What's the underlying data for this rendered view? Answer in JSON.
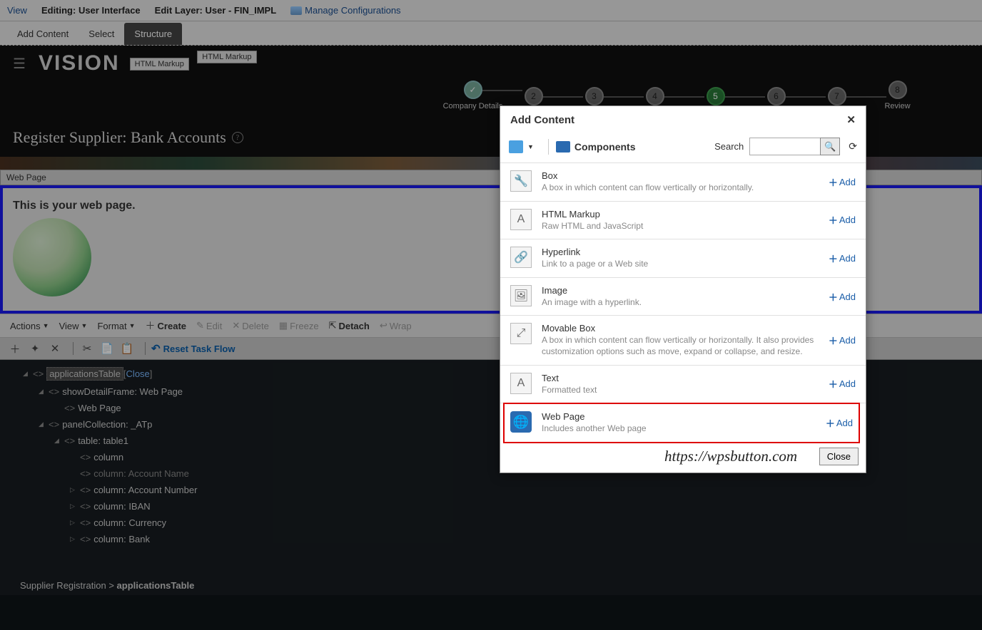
{
  "topbar": {
    "view": "View",
    "editing": "Editing: User Interface",
    "layer": "Edit Layer: User - FIN_IMPL",
    "manage": "Manage Configurations"
  },
  "tabs": {
    "add_content": "Add Content",
    "select": "Select",
    "structure": "Structure"
  },
  "badges": {
    "html1": "HTML Markup",
    "html2": "HTML Markup"
  },
  "logo": "VISION",
  "steps": [
    {
      "num": "✓",
      "label": "Company Details"
    },
    {
      "num": "2",
      "label": ""
    },
    {
      "num": "3",
      "label": ""
    },
    {
      "num": "4",
      "label": ""
    },
    {
      "num": "5",
      "label": ""
    },
    {
      "num": "6",
      "label": ""
    },
    {
      "num": "7",
      "label": ""
    },
    {
      "num": "8",
      "label": "Review"
    }
  ],
  "page_title": "Register Supplier: Bank Accounts",
  "selection_banner": "Web Page",
  "web_page_text": "This is your web page.",
  "toolbar": {
    "actions": "Actions",
    "view": "View",
    "format": "Format",
    "create": "Create",
    "edit": "Edit",
    "delete": "Delete",
    "freeze": "Freeze",
    "detach": "Detach",
    "wrap": "Wrap"
  },
  "reset": "Reset Task Flow",
  "tree": [
    {
      "indent": 1,
      "tri": "◢",
      "text": "applicationsTable",
      "selected": true,
      "close": "Close"
    },
    {
      "indent": 2,
      "tri": "◢",
      "text": "showDetailFrame: Web Page"
    },
    {
      "indent": 3,
      "tri": "",
      "text": "Web Page"
    },
    {
      "indent": 2,
      "tri": "◢",
      "text": "panelCollection: _ATp"
    },
    {
      "indent": 3,
      "tri": "◢",
      "text": "table: table1"
    },
    {
      "indent": 4,
      "tri": "",
      "text": "column"
    },
    {
      "indent": 4,
      "tri": "",
      "text": "column: Account Name",
      "dim": true
    },
    {
      "indent": 4,
      "tri": "▷",
      "text": "column: Account Number"
    },
    {
      "indent": 4,
      "tri": "▷",
      "text": "column: IBAN"
    },
    {
      "indent": 4,
      "tri": "▷",
      "text": "column: Currency"
    },
    {
      "indent": 4,
      "tri": "▷",
      "text": "column: Bank"
    }
  ],
  "breadcrumb": {
    "a": "Supplier Registration",
    "sep": ">",
    "b": "applicationsTable"
  },
  "dialog": {
    "title": "Add Content",
    "components_label": "Components",
    "search_label": "Search",
    "search_placeholder": "",
    "add_label": "Add",
    "close_label": "Close",
    "watermark": "https://wpsbutton.com",
    "items": [
      {
        "icon": "🔧",
        "title": "Box",
        "desc": "A box in which content can flow vertically or horizontally."
      },
      {
        "icon": "A",
        "title": "HTML Markup",
        "desc": "Raw HTML and JavaScript"
      },
      {
        "icon": "🔗",
        "title": "Hyperlink",
        "desc": "Link to a page or a Web site"
      },
      {
        "icon": "🖼",
        "title": "Image",
        "desc": "An image with a hyperlink."
      },
      {
        "icon": "⤢",
        "title": "Movable Box",
        "desc": "A box in which content can flow vertically or horizontally. It also provides customization options such as move, expand or collapse, and resize."
      },
      {
        "icon": "A",
        "title": "Text",
        "desc": "Formatted text"
      },
      {
        "icon": "🌐",
        "title": "Web Page",
        "desc": "Includes another Web page",
        "highlight": true
      }
    ]
  }
}
